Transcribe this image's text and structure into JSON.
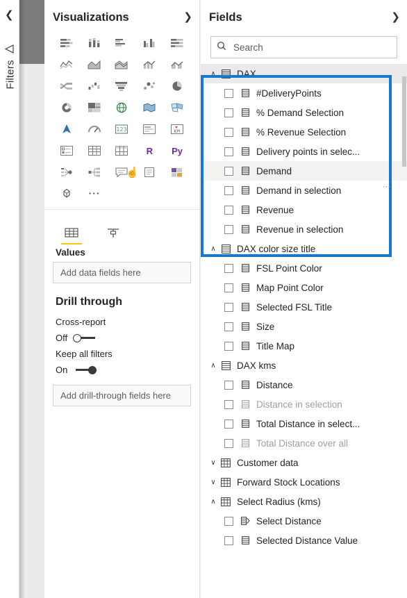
{
  "filters_rail": {
    "collapse_icon": "chevron-left-icon",
    "pin_icon": "pin-icon",
    "label": "Filters"
  },
  "visualizations": {
    "title": "Visualizations",
    "expand_icon": "chevron-right-icon",
    "icons": [
      "stacked-bar-chart-icon",
      "stacked-column-chart-icon",
      "clustered-bar-chart-icon",
      "clustered-column-chart-icon",
      "100-stacked-bar-chart-icon",
      "100-stacked-column-chart-icon",
      "line-chart-icon",
      "area-chart-icon",
      "stacked-area-chart-icon",
      "line-stacked-column-chart-icon",
      "line-clustered-column-chart-icon",
      "ribbon-chart-icon",
      "waterfall-chart-icon",
      "funnel-chart-icon",
      "scatter-chart-icon",
      "pie-chart-icon",
      "donut-chart-icon",
      "treemap-icon",
      "map-icon",
      "filled-map-icon",
      "shape-map-icon",
      "arcgis-map-icon",
      "gauge-icon",
      "card-icon",
      "multi-row-card-icon",
      "kpi-icon",
      "slicer-icon",
      "table-icon",
      "matrix-icon",
      "r-script-visual-icon",
      "python-visual-icon",
      "key-influencers-icon",
      "decomposition-tree-icon",
      "smart-narrative-icon",
      "paginated-report-icon",
      "power-apps-icon",
      "get-more-visuals-icon",
      "more-options-icon"
    ],
    "icon_text_labels": {
      "r": "R",
      "python": "Py"
    },
    "field_wells": {
      "tabs": [
        "fields-well-tab",
        "format-well-tab"
      ],
      "values_label": "Values",
      "drop_zone_placeholder": "Add data fields here"
    },
    "drill_through": {
      "title": "Drill through",
      "cross_report_label": "Cross-report",
      "cross_report_state": "Off",
      "keep_all_filters_label": "Keep all filters",
      "keep_all_filters_state": "On",
      "drop_zone_placeholder": "Add drill-through fields here"
    }
  },
  "fields": {
    "title": "Fields",
    "expand_icon": "chevron-right-icon",
    "search": {
      "placeholder": "Search",
      "value": "",
      "icon": "search-icon"
    },
    "highlight_color": "#1778d4",
    "tree": [
      {
        "type": "group",
        "label": "DAX",
        "expanded": true,
        "icon": "measure-table-icon",
        "highlighted": true,
        "children": [
          {
            "label": "#DeliveryPoints",
            "icon": "measure-icon",
            "checked": false,
            "dim": false
          },
          {
            "label": "% Demand Selection",
            "icon": "measure-icon",
            "checked": false,
            "dim": false
          },
          {
            "label": "% Revenue Selection",
            "icon": "measure-icon",
            "checked": false,
            "dim": false
          },
          {
            "label": "Delivery points in selec...",
            "icon": "measure-icon",
            "checked": false,
            "dim": false
          },
          {
            "label": "Demand",
            "icon": "measure-icon",
            "checked": false,
            "dim": false,
            "hover": true
          },
          {
            "label": "Demand in selection",
            "icon": "measure-icon",
            "checked": false,
            "dim": false
          },
          {
            "label": "Revenue",
            "icon": "measure-icon",
            "checked": false,
            "dim": false
          },
          {
            "label": "Revenue in selection",
            "icon": "measure-icon",
            "checked": false,
            "dim": false
          }
        ]
      },
      {
        "type": "group",
        "label": "DAX color size title",
        "expanded": true,
        "icon": "measure-table-icon",
        "children": [
          {
            "label": "FSL Point Color",
            "icon": "measure-icon",
            "checked": false,
            "dim": false
          },
          {
            "label": "Map Point Color",
            "icon": "measure-icon",
            "checked": false,
            "dim": false
          },
          {
            "label": "Selected FSL Title",
            "icon": "measure-icon",
            "checked": false,
            "dim": false
          },
          {
            "label": "Size",
            "icon": "measure-icon",
            "checked": false,
            "dim": false
          },
          {
            "label": "Title Map",
            "icon": "measure-icon",
            "checked": false,
            "dim": false
          }
        ]
      },
      {
        "type": "group",
        "label": "DAX kms",
        "expanded": true,
        "icon": "measure-table-icon",
        "children": [
          {
            "label": "Distance",
            "icon": "measure-icon",
            "checked": false,
            "dim": false
          },
          {
            "label": "Distance in selection",
            "icon": "measure-icon",
            "checked": false,
            "dim": true
          },
          {
            "label": "Total Distance in select...",
            "icon": "measure-icon",
            "checked": false,
            "dim": false
          },
          {
            "label": "Total Distance over all",
            "icon": "measure-icon",
            "checked": false,
            "dim": true
          }
        ]
      },
      {
        "type": "group",
        "label": "Customer data",
        "expanded": false,
        "icon": "table-icon",
        "children": []
      },
      {
        "type": "group",
        "label": "Forward Stock Locations",
        "expanded": false,
        "icon": "table-icon",
        "children": []
      },
      {
        "type": "group",
        "label": "Select Radius (kms)",
        "expanded": true,
        "icon": "table-icon",
        "children": [
          {
            "label": "Select Distance",
            "icon": "hierarchy-icon",
            "checked": false,
            "dim": false
          },
          {
            "label": "Selected Distance Value",
            "icon": "measure-icon",
            "checked": false,
            "dim": false
          }
        ]
      }
    ]
  }
}
